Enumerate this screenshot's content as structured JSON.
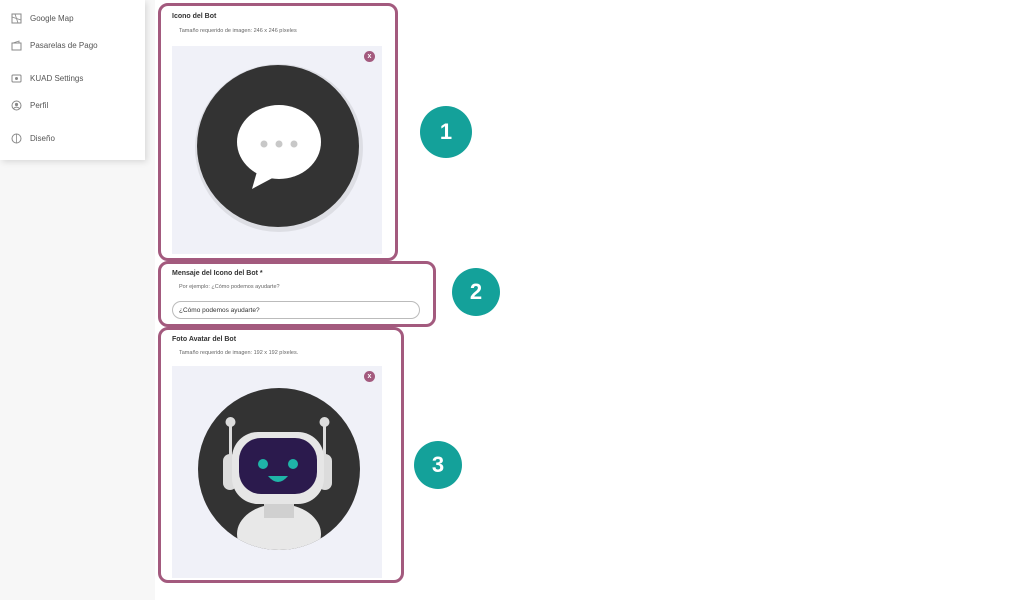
{
  "sidebar": {
    "items": [
      {
        "label": "Google Map",
        "icon": "map-icon"
      },
      {
        "label": "Pasarelas de Pago",
        "icon": "wallet-icon"
      },
      {
        "label": "KUAD Settings",
        "icon": "settings-icon"
      },
      {
        "label": "Perfil",
        "icon": "profile-icon"
      },
      {
        "label": "Diseño",
        "icon": "design-icon"
      }
    ]
  },
  "bot_icon": {
    "title": "Icono del Bot",
    "subtitle": "Tamaño requerido de imagen: 246 x 246 píxeles",
    "close_label": "x"
  },
  "bot_message": {
    "title": "Mensaje del Icono del Bot *",
    "hint": "Por ejemplo: ¿Cómo podemos ayudarte?",
    "value": "¿Cómo podemos ayudarte?"
  },
  "bot_avatar": {
    "title": "Foto Avatar del Bot",
    "subtitle": "Tamaño requerido de imagen: 192 x 192 píxeles.",
    "close_label": "x"
  },
  "steps": [
    "1",
    "2",
    "3"
  ],
  "colors": {
    "accent_border": "#a35a7e",
    "step_badge": "#14a19a",
    "image_bg": "#f0f1f8",
    "dark_circle": "#333333"
  }
}
